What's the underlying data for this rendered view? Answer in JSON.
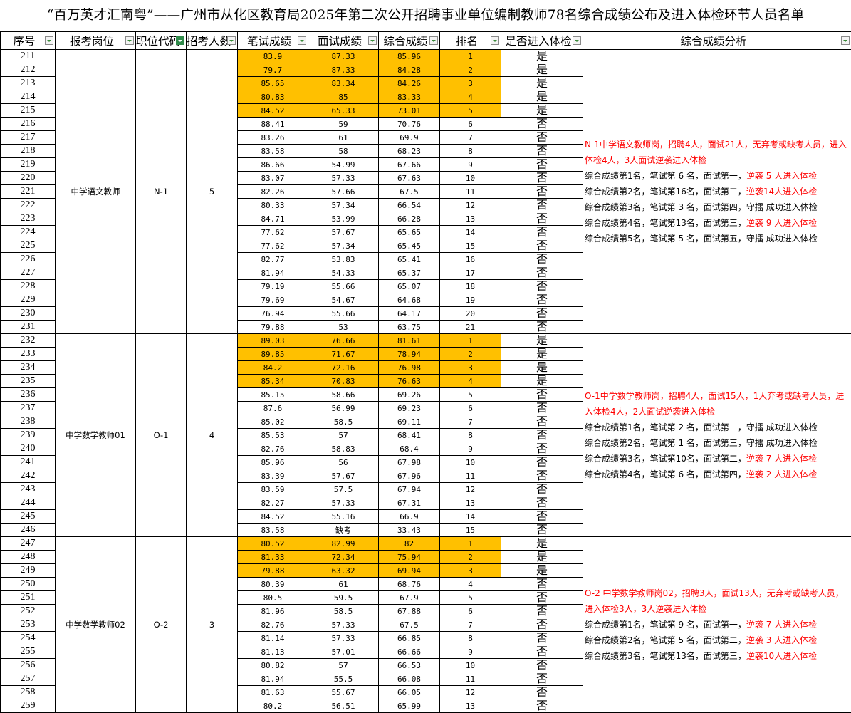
{
  "title": "“百万英才汇南粤”——广州市从化区教育局2025年第二次公开招聘事业单位编制教师78名综合成绩公布及进入体检环节人员名单",
  "headers": [
    "序号",
    "报考岗位",
    "职位代码",
    "招考人数",
    "笔试成绩",
    "面试成绩",
    "综合成绩",
    "排名",
    "是否进入体检",
    "综合成绩分析"
  ],
  "groups": [
    {
      "post": "中学语文教师",
      "code": "N-1",
      "count": "5",
      "analysis_head": "N-1中学语文教师岗，招聘4人，面试21人，无弃考或缺考人员，进入体检4人，3人面试逆袭进入体检",
      "analysis_lines": [
        {
          "plain": "综合成绩第1名，笔试第 6 名，面试第一，",
          "tail": "逆袭 5 人进入体检",
          "red": true
        },
        {
          "plain": "综合成绩第2名，笔试第16名，面试第二，",
          "tail": "逆袭14人进入体检",
          "red": true
        },
        {
          "plain": "综合成绩第3名，笔试第 3 名，面试第四，",
          "tail": "守擂 成功进入体检",
          "red": false
        },
        {
          "plain": "综合成绩第4名，笔试第13名，面试第三，",
          "tail": "逆袭 9 人进入体检",
          "red": true
        },
        {
          "plain": "综合成绩第5名，笔试第 5 名，面试第五，",
          "tail": "守擂 成功进入体检",
          "red": false
        }
      ],
      "rows": [
        [
          "211",
          "83.9",
          "87.33",
          "85.96",
          "1",
          "是"
        ],
        [
          "212",
          "79.7",
          "87.33",
          "84.28",
          "2",
          "是"
        ],
        [
          "213",
          "85.65",
          "83.34",
          "84.26",
          "3",
          "是"
        ],
        [
          "214",
          "80.83",
          "85",
          "83.33",
          "4",
          "是"
        ],
        [
          "215",
          "84.52",
          "65.33",
          "73.01",
          "5",
          "是"
        ],
        [
          "216",
          "88.41",
          "59",
          "70.76",
          "6",
          "否"
        ],
        [
          "217",
          "83.26",
          "61",
          "69.9",
          "7",
          "否"
        ],
        [
          "218",
          "83.58",
          "58",
          "68.23",
          "8",
          "否"
        ],
        [
          "219",
          "86.66",
          "54.99",
          "67.66",
          "9",
          "否"
        ],
        [
          "220",
          "83.07",
          "57.33",
          "67.63",
          "10",
          "否"
        ],
        [
          "221",
          "82.26",
          "57.66",
          "67.5",
          "11",
          "否"
        ],
        [
          "222",
          "80.33",
          "57.34",
          "66.54",
          "12",
          "否"
        ],
        [
          "223",
          "84.71",
          "53.99",
          "66.28",
          "13",
          "否"
        ],
        [
          "224",
          "77.62",
          "57.67",
          "65.65",
          "14",
          "否"
        ],
        [
          "225",
          "77.62",
          "57.34",
          "65.45",
          "15",
          "否"
        ],
        [
          "226",
          "82.77",
          "53.83",
          "65.41",
          "16",
          "否"
        ],
        [
          "227",
          "81.94",
          "54.33",
          "65.37",
          "17",
          "否"
        ],
        [
          "228",
          "79.19",
          "55.66",
          "65.07",
          "18",
          "否"
        ],
        [
          "229",
          "79.69",
          "54.67",
          "64.68",
          "19",
          "否"
        ],
        [
          "230",
          "76.94",
          "55.66",
          "64.17",
          "20",
          "否"
        ],
        [
          "231",
          "79.88",
          "53",
          "63.75",
          "21",
          "否"
        ]
      ]
    },
    {
      "post": "中学数学教师01",
      "code": "O-1",
      "count": "4",
      "analysis_head": "O-1中学数学教师岗，招聘4人，面试15人，1人弃考或缺考人员，进入体检4人，2人面试逆袭进入体检",
      "analysis_lines": [
        {
          "plain": "综合成绩第1名，笔试第 2 名，面试第一，",
          "tail": "守擂 成功进入体检",
          "red": false
        },
        {
          "plain": "综合成绩第2名，笔试第 1 名，面试第三，",
          "tail": "守擂 成功进入体检",
          "red": false
        },
        {
          "plain": "综合成绩第3名，笔试第10名，面试第二，",
          "tail": "逆袭 7 人进入体检",
          "red": true
        },
        {
          "plain": "综合成绩第4名，笔试第 6 名，面试第四，",
          "tail": "逆袭 2 人进入体检",
          "red": true
        }
      ],
      "rows": [
        [
          "232",
          "89.03",
          "76.66",
          "81.61",
          "1",
          "是"
        ],
        [
          "233",
          "89.85",
          "71.67",
          "78.94",
          "2",
          "是"
        ],
        [
          "234",
          "84.2",
          "72.16",
          "76.98",
          "3",
          "是"
        ],
        [
          "235",
          "85.34",
          "70.83",
          "76.63",
          "4",
          "是"
        ],
        [
          "236",
          "85.15",
          "58.66",
          "69.26",
          "5",
          "否"
        ],
        [
          "237",
          "87.6",
          "56.99",
          "69.23",
          "6",
          "否"
        ],
        [
          "238",
          "85.02",
          "58.5",
          "69.11",
          "7",
          "否"
        ],
        [
          "239",
          "85.53",
          "57",
          "68.41",
          "8",
          "否"
        ],
        [
          "240",
          "82.76",
          "58.83",
          "68.4",
          "9",
          "否"
        ],
        [
          "241",
          "85.96",
          "56",
          "67.98",
          "10",
          "否"
        ],
        [
          "242",
          "83.39",
          "57.67",
          "67.96",
          "11",
          "否"
        ],
        [
          "243",
          "83.59",
          "57.5",
          "67.94",
          "12",
          "否"
        ],
        [
          "244",
          "82.27",
          "57.33",
          "67.31",
          "13",
          "否"
        ],
        [
          "245",
          "84.52",
          "55.16",
          "66.9",
          "14",
          "否"
        ],
        [
          "246",
          "83.58",
          "缺考",
          "33.43",
          "15",
          "否"
        ]
      ]
    },
    {
      "post": "中学数学教师02",
      "code": "O-2",
      "count": "3",
      "analysis_head": "O-2 中学数学教师岗02，招聘3人，面试13人，无弃考或缺考人员，进入体检3人，3人逆袭进入体检",
      "analysis_lines": [
        {
          "plain": "综合成绩第1名，笔试第 9 名，面试第一，",
          "tail": "逆袭 7 人进入体检",
          "red": true
        },
        {
          "plain": "综合成绩第2名，笔试第 5 名，面试第二，",
          "tail": "逆袭 3 人进入体检",
          "red": true
        },
        {
          "plain": "综合成绩第3名，笔试第13名，面试第三，",
          "tail": "逆袭10人进入体检",
          "red": true
        }
      ],
      "rows": [
        [
          "247",
          "80.52",
          "82.99",
          "82",
          "1",
          "是"
        ],
        [
          "248",
          "81.33",
          "72.34",
          "75.94",
          "2",
          "是"
        ],
        [
          "249",
          "79.88",
          "63.32",
          "69.94",
          "3",
          "是"
        ],
        [
          "250",
          "80.39",
          "61",
          "68.76",
          "4",
          "否"
        ],
        [
          "251",
          "80.5",
          "59.5",
          "67.9",
          "5",
          "否"
        ],
        [
          "252",
          "81.96",
          "58.5",
          "67.88",
          "6",
          "否"
        ],
        [
          "253",
          "82.76",
          "57.33",
          "67.5",
          "7",
          "否"
        ],
        [
          "254",
          "81.14",
          "57.33",
          "66.85",
          "8",
          "否"
        ],
        [
          "255",
          "81.13",
          "57.01",
          "66.66",
          "9",
          "否"
        ],
        [
          "256",
          "80.82",
          "57",
          "66.53",
          "10",
          "否"
        ],
        [
          "257",
          "81.94",
          "55.5",
          "66.08",
          "11",
          "否"
        ],
        [
          "258",
          "81.63",
          "55.67",
          "66.05",
          "12",
          "否"
        ],
        [
          "259",
          "80.2",
          "56.51",
          "65.99",
          "13",
          "否"
        ]
      ]
    }
  ]
}
